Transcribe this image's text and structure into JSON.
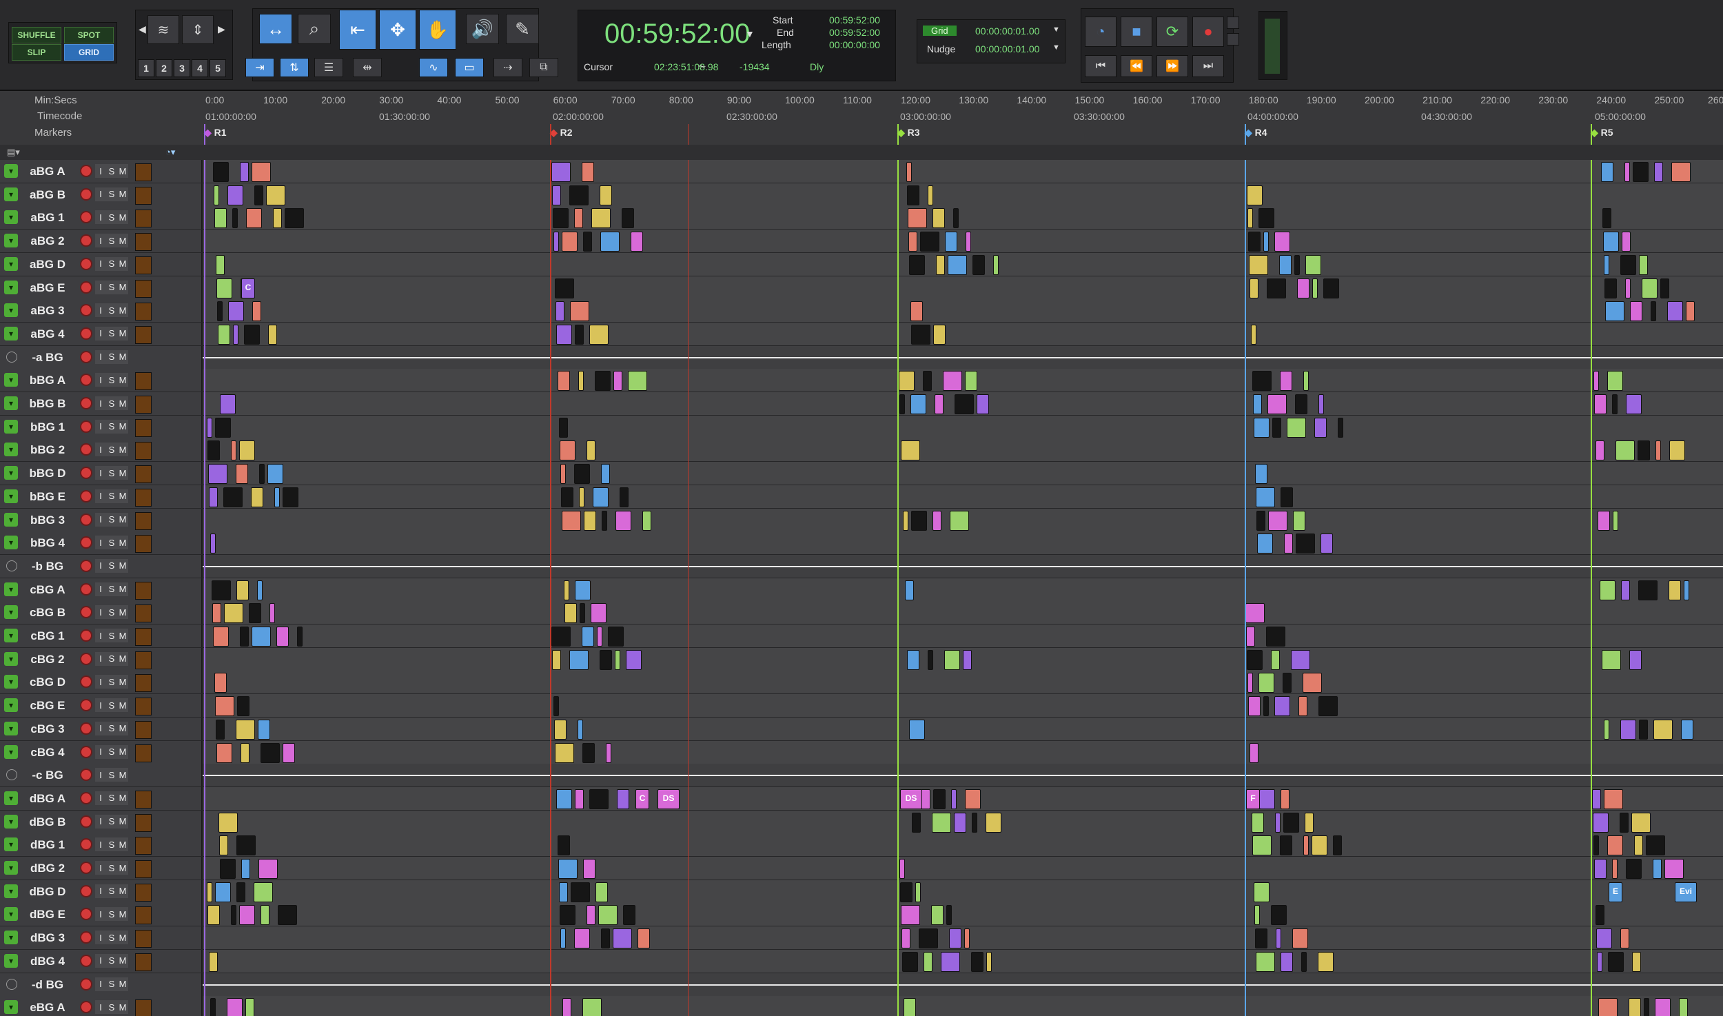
{
  "edit_modes": {
    "shuffle": "SHUFFLE",
    "spot": "SPOT",
    "slip": "SLIP",
    "grid": "GRID"
  },
  "zoom_presets": [
    "1",
    "2",
    "3",
    "4",
    "5"
  ],
  "counter": {
    "main": "00:59:52:00",
    "start_label": "Start",
    "start": "00:59:52:00",
    "end_label": "End",
    "end": "00:59:52:00",
    "length_label": "Length",
    "length": "00:00:00:00",
    "cursor_label": "Cursor",
    "cursor": "02:23:51:08.98",
    "cursor_value": "-19434",
    "dly": "Dly"
  },
  "grid": {
    "grid_label": "Grid",
    "grid_value": "00:00:00:01.00",
    "nudge_label": "Nudge",
    "nudge_value": "00:00:00:01.00"
  },
  "rulers": {
    "minsecs_label": "Min:Secs",
    "timecode_label": "Timecode",
    "markers_label": "Markers",
    "minsecs_ticks": [
      "0:00",
      "10:00",
      "20:00",
      "30:00",
      "40:00",
      "50:00",
      "60:00",
      "70:00",
      "80:00",
      "90:00",
      "100:00",
      "110:00",
      "120:00",
      "130:00",
      "140:00",
      "150:00",
      "160:00",
      "170:00",
      "180:00",
      "190:00",
      "200:00",
      "210:00",
      "220:00",
      "230:00",
      "240:00",
      "250:00",
      "260"
    ],
    "timecode_ticks": [
      "01:00:00:00",
      "01:30:00:00",
      "02:00:00:00",
      "02:30:00:00",
      "03:00:00:00",
      "03:30:00:00",
      "04:00:00:00",
      "04:30:00:00",
      "05:00:00:00"
    ],
    "markers": [
      {
        "name": "R1",
        "color": "#c25ae0"
      },
      {
        "name": "R2",
        "color": "#e0413a"
      },
      {
        "name": "R3",
        "color": "#98e040"
      },
      {
        "name": "R4",
        "color": "#5ba6ea"
      },
      {
        "name": "R5",
        "color": "#98e040"
      }
    ]
  },
  "track_buttons": {
    "input": "I",
    "solo": "S",
    "mute": "M"
  },
  "tracks": [
    {
      "name": "aBG A",
      "type": "audio"
    },
    {
      "name": "aBG B",
      "type": "audio"
    },
    {
      "name": "aBG 1",
      "type": "audio"
    },
    {
      "name": "aBG 2",
      "type": "audio"
    },
    {
      "name": "aBG D",
      "type": "audio"
    },
    {
      "name": "aBG E",
      "type": "audio"
    },
    {
      "name": "aBG 3",
      "type": "audio"
    },
    {
      "name": "aBG 4",
      "type": "audio"
    },
    {
      "name": "-a BG",
      "type": "vca"
    },
    {
      "name": "bBG A",
      "type": "audio"
    },
    {
      "name": "bBG B",
      "type": "audio"
    },
    {
      "name": "bBG 1",
      "type": "audio"
    },
    {
      "name": "bBG 2",
      "type": "audio"
    },
    {
      "name": "bBG D",
      "type": "audio"
    },
    {
      "name": "bBG E",
      "type": "audio"
    },
    {
      "name": "bBG 3",
      "type": "audio"
    },
    {
      "name": "bBG 4",
      "type": "audio"
    },
    {
      "name": "-b BG",
      "type": "vca"
    },
    {
      "name": "cBG A",
      "type": "audio"
    },
    {
      "name": "cBG B",
      "type": "audio"
    },
    {
      "name": "cBG 1",
      "type": "audio"
    },
    {
      "name": "cBG 2",
      "type": "audio"
    },
    {
      "name": "cBG D",
      "type": "audio"
    },
    {
      "name": "cBG E",
      "type": "audio"
    },
    {
      "name": "cBG 3",
      "type": "audio"
    },
    {
      "name": "cBG 4",
      "type": "audio"
    },
    {
      "name": "-c BG",
      "type": "vca"
    },
    {
      "name": "dBG A",
      "type": "audio"
    },
    {
      "name": "dBG B",
      "type": "audio"
    },
    {
      "name": "dBG 1",
      "type": "audio"
    },
    {
      "name": "dBG 2",
      "type": "audio"
    },
    {
      "name": "dBG D",
      "type": "audio"
    },
    {
      "name": "dBG E",
      "type": "audio"
    },
    {
      "name": "dBG 3",
      "type": "audio"
    },
    {
      "name": "dBG 4",
      "type": "audio"
    },
    {
      "name": "-d BG",
      "type": "vca"
    },
    {
      "name": "eBG A",
      "type": "audio"
    }
  ],
  "clip_labels": [
    "C",
    "DS",
    "DS",
    "C",
    "F",
    "E",
    "Evi"
  ],
  "colors": {
    "clip_green": "#9bd36b",
    "clip_purple": "#9a66e0",
    "clip_red": "#e27d6b",
    "clip_yellow": "#d9c35a",
    "clip_blue": "#5a9fe0",
    "clip_pink": "#d86ad8",
    "track_green": "#4fae36"
  }
}
